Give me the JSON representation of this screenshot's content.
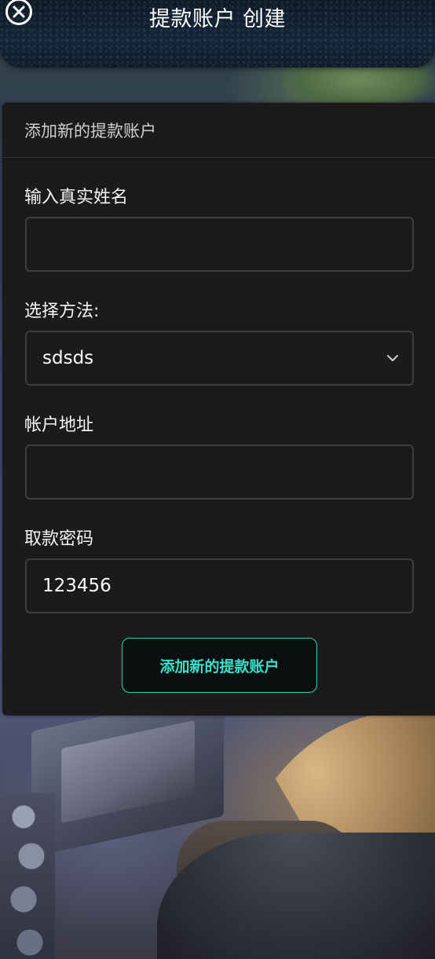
{
  "header": {
    "title": "提款账户 创建",
    "close_icon": "close-circle-icon"
  },
  "card": {
    "title": "添加新的提款账户",
    "fields": [
      {
        "label": "输入真实姓名",
        "value": "",
        "placeholder": ""
      },
      {
        "label": "选择方法:",
        "value": "sdsds",
        "icon": "chevron-down-icon"
      },
      {
        "label": "帐户地址",
        "value": "",
        "placeholder": ""
      },
      {
        "label": "取款密码",
        "value": "123456"
      }
    ],
    "submit_label": "添加新的提款账户"
  },
  "colors": {
    "accent": "#37e0cc",
    "card_bg": "#1b1b1b",
    "field_border": "#3f3f3f"
  }
}
